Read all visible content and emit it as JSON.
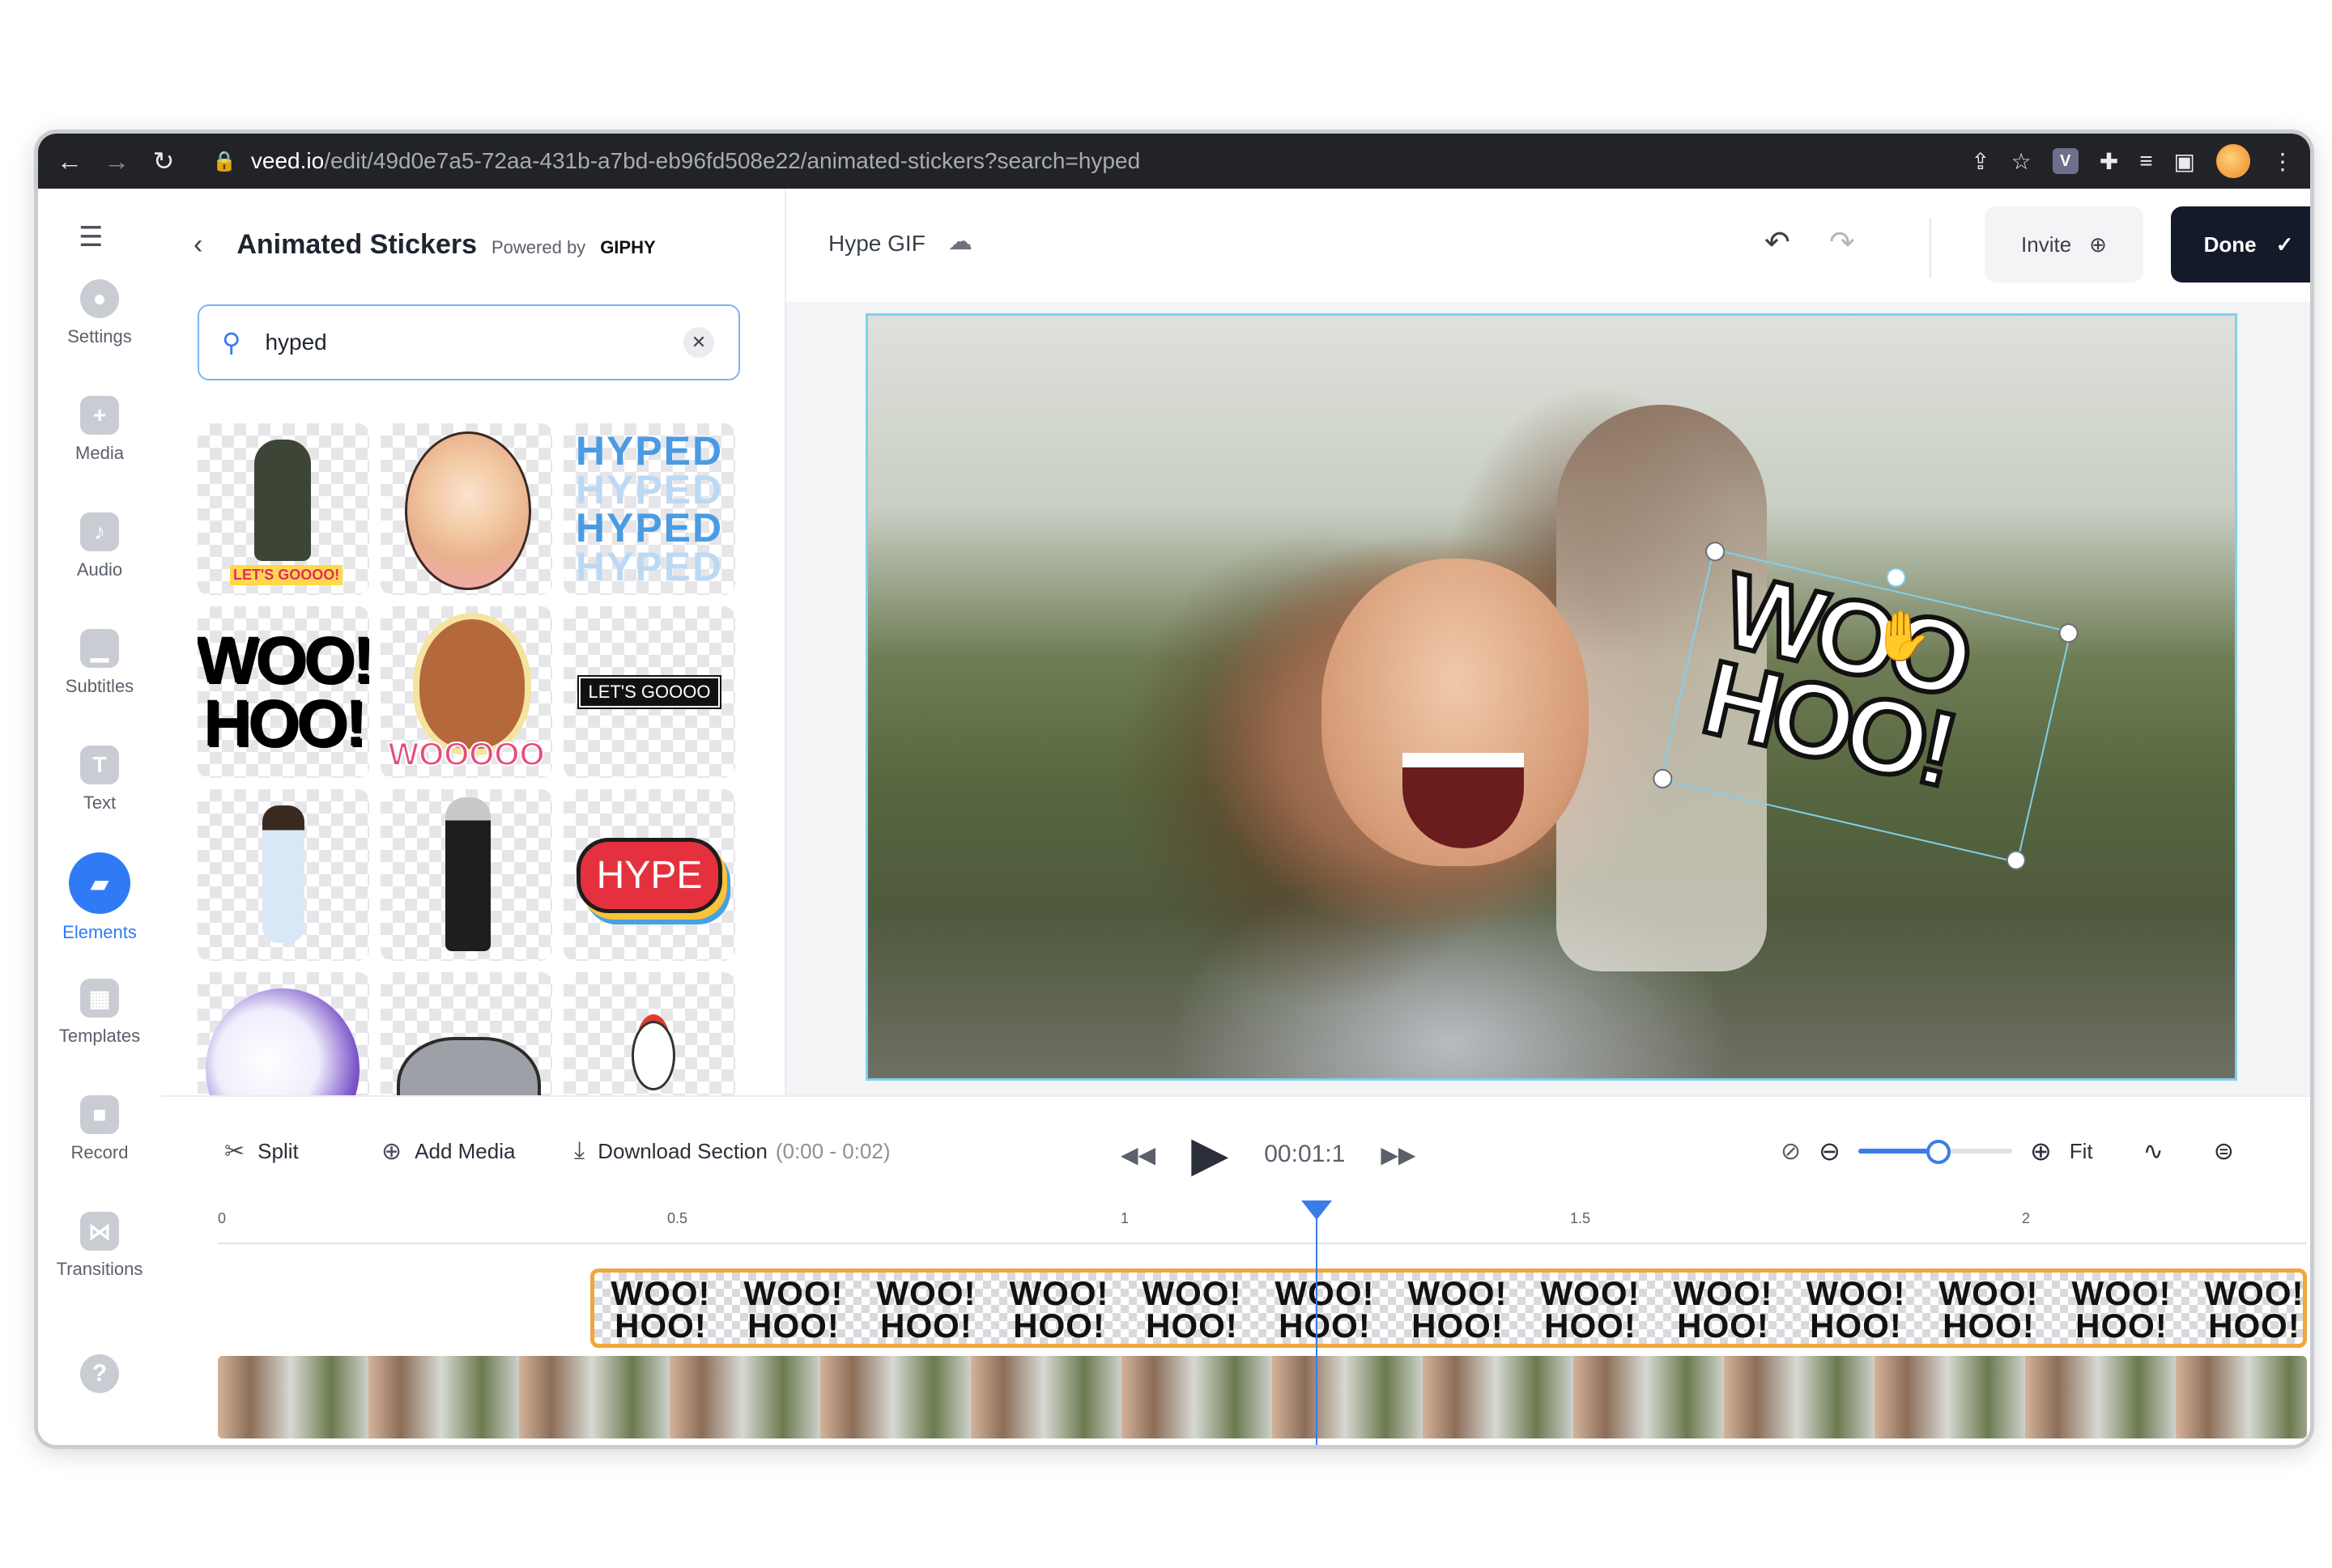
{
  "browser": {
    "url_host": "veed.io",
    "url_path": "/edit/49d0e7a5-72aa-431b-a7bd-eb96fd508e22/animated-stickers?search=hyped",
    "ext_letter": "V"
  },
  "rail": {
    "items": [
      {
        "label": "Settings"
      },
      {
        "label": "Media"
      },
      {
        "label": "Audio"
      },
      {
        "label": "Subtitles"
      },
      {
        "label": "Text",
        "glyph": "T"
      },
      {
        "label": "Elements"
      },
      {
        "label": "Templates"
      },
      {
        "label": "Record"
      },
      {
        "label": "Transitions"
      }
    ],
    "help_glyph": "?"
  },
  "panel": {
    "title": "Animated Stickers",
    "powered_by": "Powered by",
    "brand": "GIPHY",
    "search_value": "hyped",
    "stickers": {
      "lets_go_small": "LET'S GOOOO!",
      "hyped_word": "HYPED",
      "woo": "WOO!",
      "hoo": "HOO!",
      "woodoo": "WOOOOO",
      "lets_go_tag": "LET'S GOOOO",
      "hype": "HYPE"
    }
  },
  "editor": {
    "project_name": "Hype GIF",
    "invite_label": "Invite",
    "done_label": "Done",
    "sticker_line1": "WOO",
    "sticker_line2": "HOO!"
  },
  "timeline": {
    "split_label": "Split",
    "add_media_label": "Add Media",
    "download_label": "Download Section",
    "download_range": "(0:00 - 0:02)",
    "timecode": "00:01:1",
    "fit_label": "Fit",
    "zoom_level": 0.5,
    "ruler_ticks": [
      "0",
      "0.5",
      "1",
      "1.5",
      "2"
    ],
    "track_frame_top": "WOO!",
    "track_frame_bottom": "HOO!"
  },
  "colors": {
    "accent": "#2f7bf6",
    "done_bg": "#151a2b",
    "track_border": "#f0a63a"
  }
}
